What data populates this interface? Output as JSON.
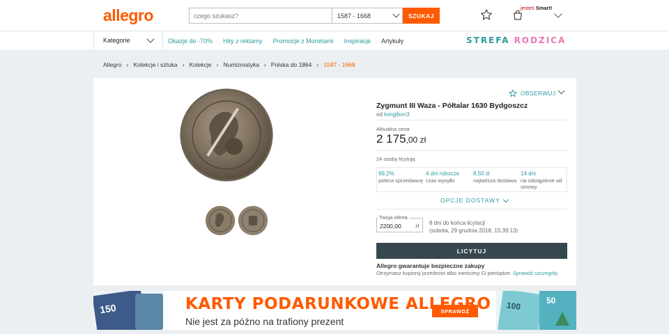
{
  "header": {
    "logo": "allegro",
    "search_placeholder": "czego szukasz?",
    "search_category": "1587 - 1668",
    "search_button": "SZUKAJ",
    "smart_prefix": "jesteś",
    "smart_label": "Smart!"
  },
  "nav": {
    "categories": "Kategorie",
    "links": [
      "Okazje do -70%",
      "Hity z reklamy",
      "Promocje z Monetami",
      "Inspiracje",
      "Artykuły"
    ],
    "promo": "STREFA RODZICA"
  },
  "breadcrumb": [
    "Allegro",
    "Kolekcje i sztuka",
    "Kolekcje",
    "Numizmatyka",
    "Polska do 1864",
    "1587 - 1668"
  ],
  "product": {
    "observe": "OBSERWUJ",
    "title": "Zygmunt III Waza - Półtalar 1630 Bydgoszcz",
    "seller_prefix": "od",
    "seller": "ksngibon3",
    "price_label": "Aktualna cena",
    "price_main": "2 175",
    "price_cents": ",00 zł",
    "bidders": "24 osoby licytują",
    "stats": [
      {
        "value": "99,2%",
        "label": "poleca sprzedawcę"
      },
      {
        "value": "4 dni robocze",
        "label": "czas wysyłki"
      },
      {
        "value": "8,50 zł",
        "label": "najtańsza dostawa"
      },
      {
        "value": "14 dni",
        "label": "na odstąpienie od umowy"
      }
    ],
    "delivery": "OPCJE DOSTAWY",
    "offer_label": "Twoja oferta",
    "offer_value": "2200,00",
    "offer_currency": "zł",
    "deadline_1": "8 dni do końca licytacji",
    "deadline_2": "(sobota, 29 grudnia 2018, 15:39:13)",
    "bid_button": "LICYTUJ",
    "guarantee": "Allegro gwarantuje bezpieczne zakupy",
    "guarantee_sub": "Otrzymasz kupiony przedmiot albo zwrócimy Ci pieniądze.",
    "guarantee_link": "Sprawdź szczegóły."
  },
  "banner": {
    "title": "KARTY PODARUNKOWE ALLEGRO",
    "subtitle": "Nie jest za późno na trafiony prezent",
    "button": "SPRAWDŹ",
    "card_left_value": "150",
    "card_right_value_a": "100",
    "card_right_value_b": "50"
  },
  "colors": {
    "accent": "#ff5a00",
    "link": "#2e9aa0",
    "button_dark": "#37474f"
  }
}
